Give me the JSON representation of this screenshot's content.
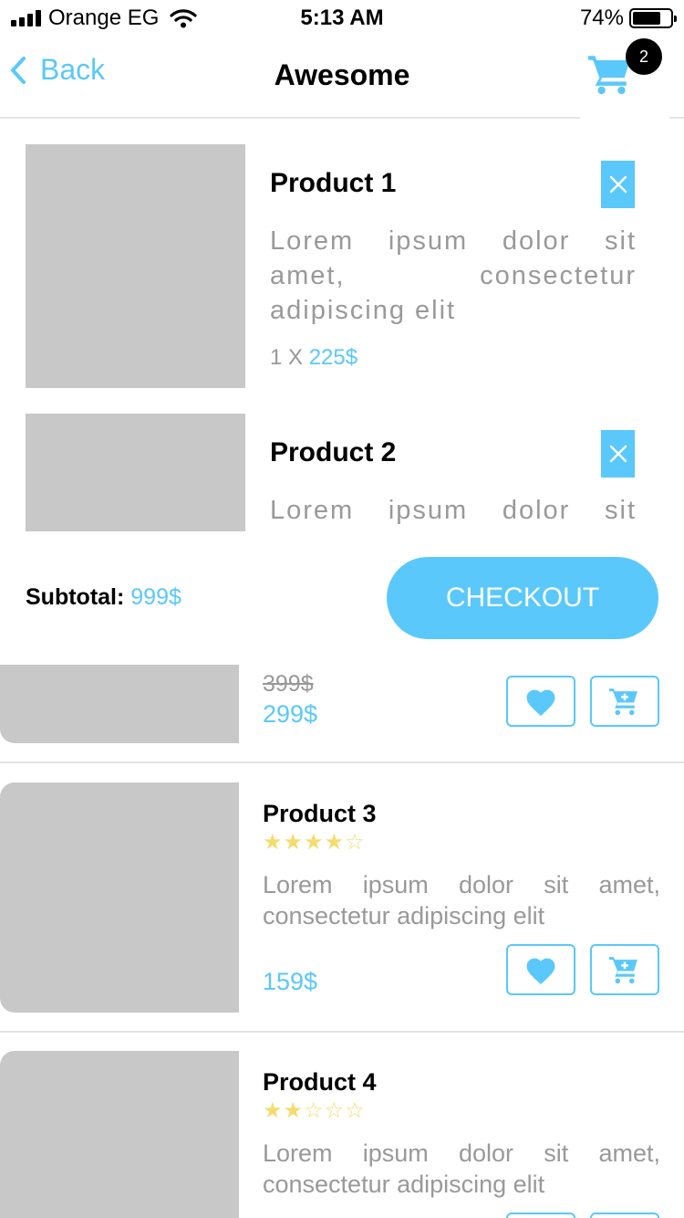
{
  "status_bar": {
    "carrier": "Orange EG",
    "time": "5:13 AM",
    "battery": "74%",
    "battery_level": 0.74
  },
  "nav": {
    "back_label": "Back",
    "title": "Awesome",
    "cart_count": "2",
    "icons": {
      "back": "chevron-left-icon",
      "cart": "cart-icon"
    }
  },
  "cart": {
    "items": [
      {
        "name": "Product 1",
        "description": "Lorem ipsum dolor sit amet, consectetur adipiscing elit",
        "quantity": "1 X ",
        "price": "225$"
      },
      {
        "name": "Product 2",
        "description": "Lorem ipsum dolor sit"
      }
    ],
    "subtotal_label": "Subtotal:",
    "subtotal_value": "999$",
    "checkout_label": "CHECKOUT"
  },
  "products": [
    {
      "old_price": "399$",
      "price": "299$"
    },
    {
      "name": "Product 3",
      "stars": "★★★★☆",
      "rating": 4,
      "description": "Lorem ipsum dolor sit amet, consectetur adipiscing elit",
      "price": "159$"
    },
    {
      "name": "Product 4",
      "stars": "★★☆☆☆",
      "rating": 2,
      "description": "Lorem ipsum dolor sit amet, consectetur adipiscing elit"
    }
  ],
  "colors": {
    "accent": "#5ac8fa",
    "star": "#f5dc6c",
    "placeholder": "#c8c8c8",
    "muted_text": "#999999"
  }
}
